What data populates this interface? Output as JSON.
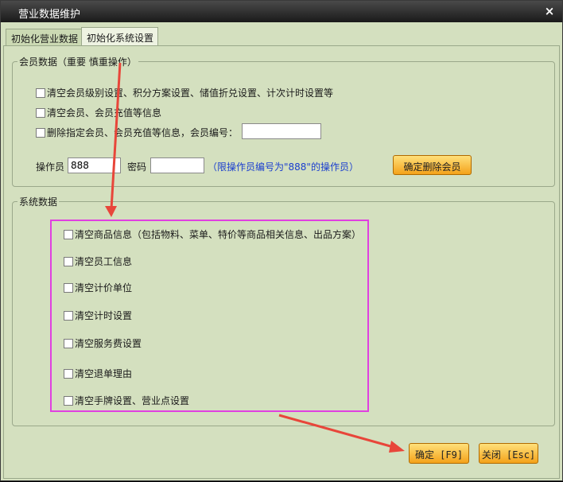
{
  "window": {
    "title": "营业数据维护",
    "close_glyph": "×"
  },
  "tabs": [
    {
      "label": "初始化营业数据",
      "active": false
    },
    {
      "label": "初始化系统设置",
      "active": true
    }
  ],
  "member_group": {
    "legend": "会员数据（重要 慎重操作）",
    "options": [
      "清空会员级别设置、积分方案设置、储值折兑设置、计次计时设置等",
      "清空会员、会员充值等信息",
      "删除指定会员、会员充值等信息，会员编号："
    ],
    "member_no_value": "",
    "operator_label": "操作员",
    "operator_value": "888",
    "password_label": "密码",
    "password_value": "",
    "hint": "（限操作员编号为\"888\"的操作员）",
    "delete_button": "确定删除会员"
  },
  "system_group": {
    "legend": "系统数据",
    "options": [
      "清空商品信息（包括物料、菜单、特价等商品相关信息、出品方案）",
      "清空员工信息",
      "清空计价单位",
      "清空计时设置",
      "清空服务费设置",
      "清空退单理由",
      "清空手牌设置、营业点设置"
    ]
  },
  "footer": {
    "ok_button": "确定 [F9]",
    "close_button": "关闭 [Esc]"
  },
  "colors": {
    "background": "#d4e0bf",
    "titlebar": "#1a1a1a",
    "button": "#f4a21a",
    "highlight_box": "#e040e0",
    "arrow": "#e8463a",
    "hint_text": "#1b3fcf"
  }
}
